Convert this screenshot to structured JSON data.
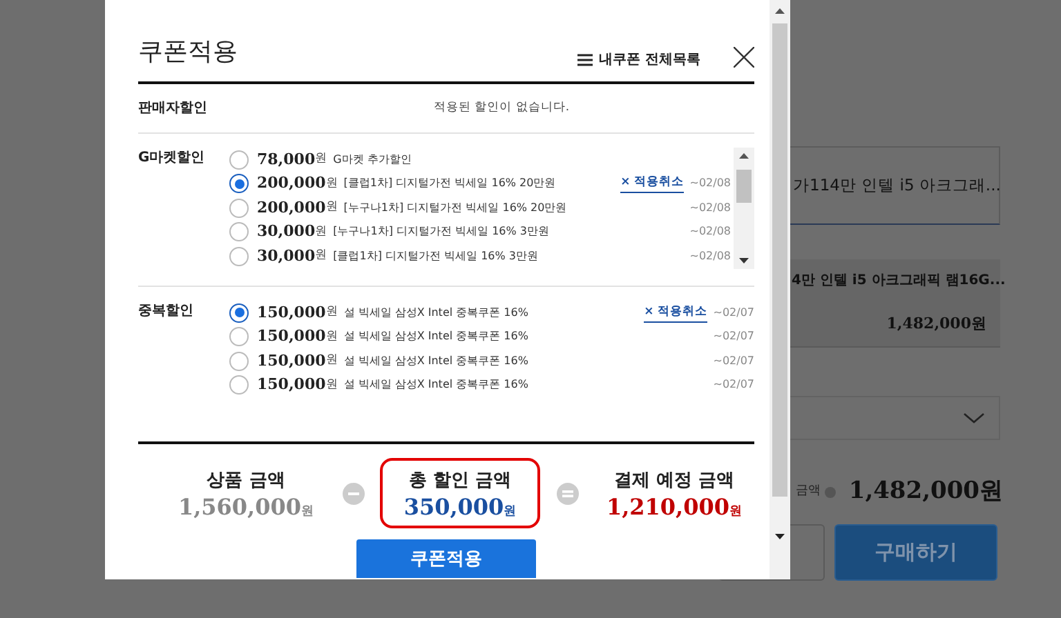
{
  "background": {
    "option_select": "가114만 인텔 i5 아크그래...",
    "selected_item": {
      "name": "4만 인텔 i5 아크그래픽 램16G...",
      "price": "1,482,000원"
    },
    "total_label": "금액",
    "total": "1,482,000원",
    "buy_button": "구매하기"
  },
  "modal": {
    "title": "쿠폰적용",
    "list_link": "내쿠폰 전체목록",
    "seller": {
      "label": "판매자할인",
      "message": "적용된 할인이 없습니다."
    },
    "sections": [
      {
        "label": "G마켓할인",
        "scrollable": true,
        "coupons": [
          {
            "amount": "78,000",
            "unit": "원",
            "name": "G마켓 추가할인",
            "selected": false
          },
          {
            "amount": "200,000",
            "unit": "원",
            "name": "[클럽1차] 디지털가전 빅세일 16% 20만원",
            "selected": true,
            "cancel": "× 적용취소",
            "expiry": "~02/08"
          },
          {
            "amount": "200,000",
            "unit": "원",
            "name": "[누구나1차] 디지털가전 빅세일 16% 20만원",
            "selected": false,
            "expiry": "~02/08"
          },
          {
            "amount": "30,000",
            "unit": "원",
            "name": "[누구나1차] 디지털가전 빅세일 16% 3만원",
            "selected": false,
            "expiry": "~02/08"
          },
          {
            "amount": "30,000",
            "unit": "원",
            "name": "[클럽1차] 디지털가전 빅세일 16% 3만원",
            "selected": false,
            "expiry": "~02/08"
          }
        ]
      },
      {
        "label": "중복할인",
        "scrollable": false,
        "coupons": [
          {
            "amount": "150,000",
            "unit": "원",
            "name": "설 빅세일 삼성X Intel 중복쿠폰 16%",
            "selected": true,
            "cancel": "× 적용취소",
            "expiry": "~02/07"
          },
          {
            "amount": "150,000",
            "unit": "원",
            "name": "설 빅세일 삼성X Intel 중복쿠폰 16%",
            "selected": false,
            "expiry": "~02/07"
          },
          {
            "amount": "150,000",
            "unit": "원",
            "name": "설 빅세일 삼성X Intel 중복쿠폰 16%",
            "selected": false,
            "expiry": "~02/07"
          },
          {
            "amount": "150,000",
            "unit": "원",
            "name": "설 빅세일 삼성X Intel 중복쿠폰 16%",
            "selected": false,
            "expiry": "~02/07"
          }
        ]
      }
    ],
    "summary": [
      {
        "kind": "product",
        "label": "상품 금액",
        "amount": "1,560,000",
        "unit": "원"
      },
      {
        "kind": "minus"
      },
      {
        "kind": "discount",
        "label": "총 할인 금액",
        "amount": "350,000",
        "unit": "원"
      },
      {
        "kind": "equals"
      },
      {
        "kind": "total",
        "label": "결제 예정 금액",
        "amount": "1,210,000",
        "unit": "원"
      }
    ],
    "apply_button": "쿠폰적용"
  }
}
